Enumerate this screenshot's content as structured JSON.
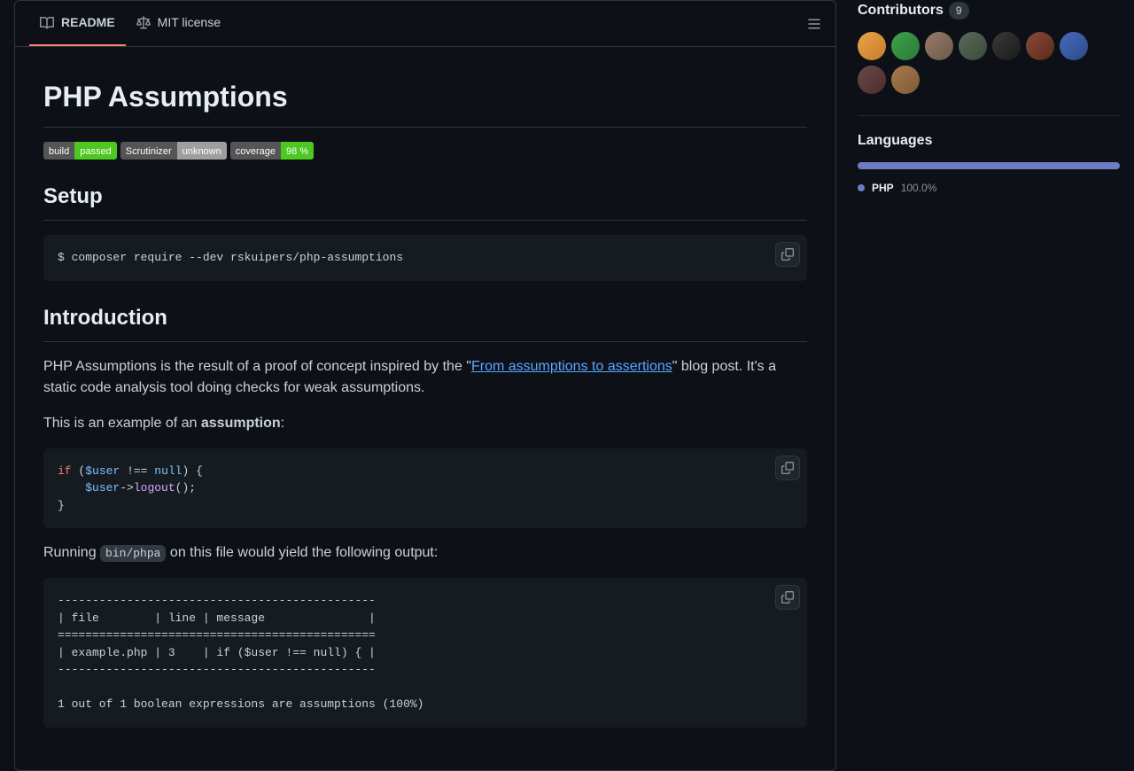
{
  "tabs": {
    "readme": "README",
    "license": "MIT license"
  },
  "readme": {
    "title": "PHP Assumptions",
    "badges": [
      {
        "left": "build",
        "right": "passed",
        "color": "green"
      },
      {
        "left": "Scrutinizer",
        "right": "unknown",
        "color": "gray"
      },
      {
        "left": "coverage",
        "right": "98 %",
        "color": "green"
      }
    ],
    "setup_heading": "Setup",
    "setup_code": "$ composer require --dev rskuipers/php-assumptions",
    "intro_heading": "Introduction",
    "intro_text_before": "PHP Assumptions is the result of a proof of concept inspired by the \"",
    "intro_link": "From assumptions to assertions",
    "intro_text_after": "\" blog post. It's a static code analysis tool doing checks for weak assumptions.",
    "example_text_before": "This is an example of an ",
    "example_strong": "assumption",
    "example_text_after": ":",
    "running_text_before": "Running ",
    "running_code": "bin/phpa",
    "running_text_after": " on this file would yield the following output:",
    "output_code": "----------------------------------------------\n| file        | line | message               |\n==============================================\n| example.php | 3    | if ($user !== null) { |\n----------------------------------------------\n\n1 out of 1 boolean expressions are assumptions (100%)"
  },
  "sidebar": {
    "contributors_label": "Contributors",
    "contributors_count": "9",
    "languages_label": "Languages",
    "languages": [
      {
        "name": "PHP",
        "pct": "100.0%"
      }
    ]
  },
  "avatars": [
    {
      "bg": "#d49c3e"
    },
    {
      "bg": "#3fa14a"
    },
    {
      "bg": "#8a6d5f"
    },
    {
      "bg": "#4a5a4a"
    },
    {
      "bg": "#2a2a2a"
    },
    {
      "bg": "#7a3a2a"
    },
    {
      "bg": "#3a5a9a"
    },
    {
      "bg": "#5a3a3a"
    },
    {
      "bg": "#8a5a3a"
    }
  ]
}
